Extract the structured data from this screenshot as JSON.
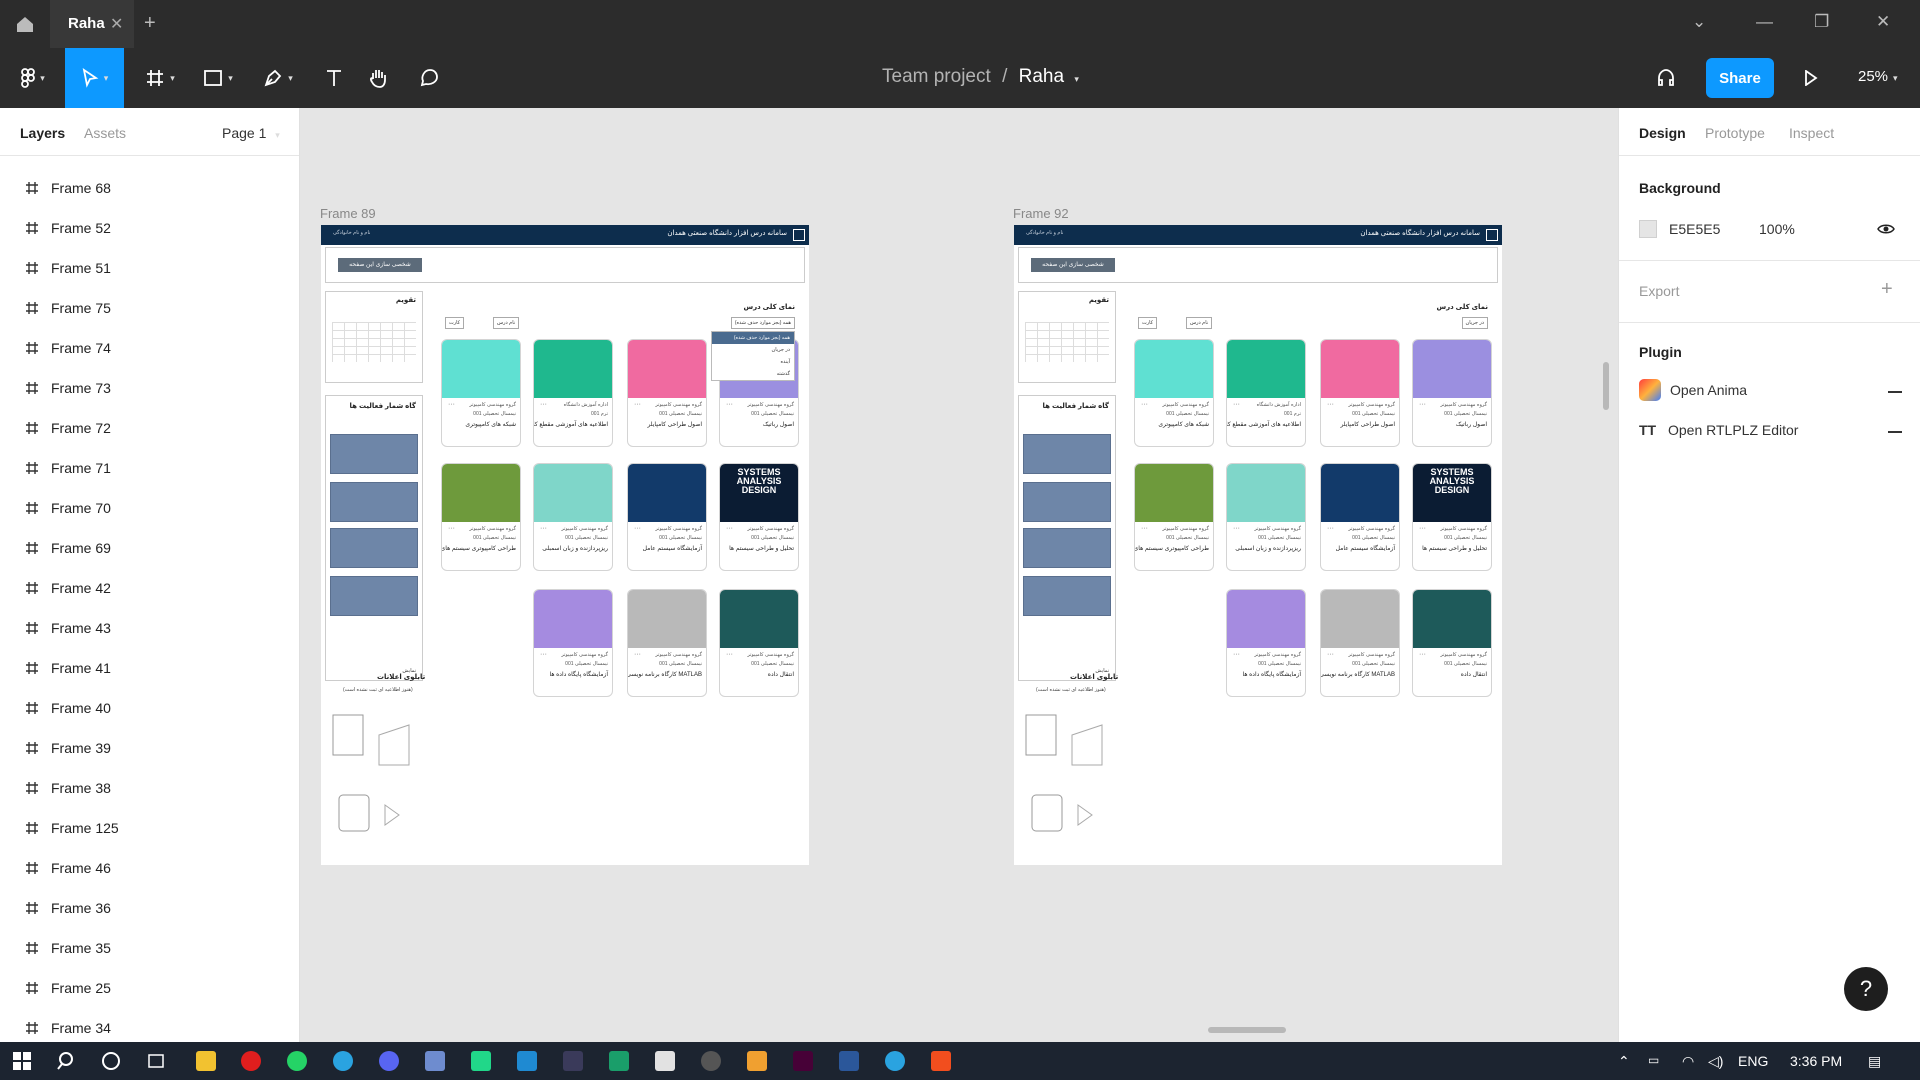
{
  "titlebar": {
    "tab_title": "Raha",
    "close_glyph": "✕",
    "new_tab_glyph": "+"
  },
  "toolbar": {
    "breadcrumb_team": "Team project",
    "breadcrumb_sep": "/",
    "breadcrumb_file": "Raha",
    "share_label": "Share",
    "zoom": "25%"
  },
  "left_panel": {
    "tab_layers": "Layers",
    "tab_assets": "Assets",
    "page": "Page 1",
    "layers": [
      "Frame 68",
      "Frame 52",
      "Frame 51",
      "Frame 75",
      "Frame 74",
      "Frame 73",
      "Frame 72",
      "Frame 71",
      "Frame 70",
      "Frame 69",
      "Frame 42",
      "Frame 43",
      "Frame 41",
      "Frame 40",
      "Frame 39",
      "Frame 38",
      "Frame 125",
      "Frame 46",
      "Frame 36",
      "Frame 35",
      "Frame 25",
      "Frame 34"
    ]
  },
  "canvas": {
    "frame_a_label": "Frame 89",
    "frame_b_label": "Frame 92",
    "frame": {
      "header_title": "سامانه درس افزار دانشگاه صنعتی همدان",
      "header_user": "نام و نام خانوادگی",
      "customize_button": "شخصی سازی این صفحه",
      "calendar_title": "تقویم",
      "activity_title": "گاه شمار فعالیت ها",
      "notice_title": "تابلوی اعلانات",
      "notice_empty": "(هنوز اطلاعیه ای ثبت نشده است)",
      "overview_title": "نمای کلی درس",
      "filter_a": "همه (بجز موارد حذف شده)",
      "filter_b": "در جریان",
      "sort_label": "نام درس",
      "view_label": "کارت",
      "menu_items": [
        "همه (بجز موارد حذف شده)",
        "در جریان",
        "آینده",
        "گذشته"
      ],
      "show_more": "نمایش"
    },
    "cards": [
      {
        "dept": "گروه مهندسی کامپیوتر",
        "term": "نیمسال تحصیلی 001",
        "name": "اصول رباتیک",
        "color": "#9b8fe0"
      },
      {
        "dept": "گروه مهندسی کامپیوتر",
        "term": "نیمسال تحصیلی 001",
        "name": "اصول طراحی کامپایلر",
        "color": "#f06aa0"
      },
      {
        "dept": "اداره آموزش دانشگاه",
        "term": "ترم 001",
        "name": "اطلاعیه های آموزشی مقطع کارشناسی",
        "color": "#1fb88e"
      },
      {
        "dept": "گروه مهندسی کامپیوتر",
        "term": "نیمسال تحصیلی 001",
        "name": "شبکه های کامپیوتری",
        "color": "#5fe0d2"
      },
      {
        "dept": "گروه مهندسی کامپیوتر",
        "term": "نیمسال تحصیلی 001",
        "name": "تحلیل و طراحی سیستم ها",
        "color": "#0b1c33"
      },
      {
        "dept": "گروه مهندسی کامپیوتر",
        "term": "نیمسال تحصیلی 001",
        "name": "آزمایشگاه سیستم عامل",
        "color": "#123a6a"
      },
      {
        "dept": "گروه مهندسی کامپیوتر",
        "term": "نیمسال تحصیلی 001",
        "name": "ریزپردازنده و زبان اسمبلی",
        "color": "#7fd6c9"
      },
      {
        "dept": "گروه مهندسی کامپیوتر",
        "term": "نیمسال تحصیلی 001",
        "name": "طراحی کامپیوتری سیستم های دیجیتال",
        "color": "#6e9a3c"
      },
      {
        "dept": "گروه مهندسی کامپیوتر",
        "term": "نیمسال تحصیلی 001",
        "name": "انتقال داده",
        "color": "#1e5a5a"
      },
      {
        "dept": "گروه مهندسی کامپیوتر",
        "term": "نیمسال تحصیلی 001",
        "name": "کارگاه برنامه نویسی MATLAB",
        "color": "#b9b9b9"
      },
      {
        "dept": "گروه مهندسی کامپیوتر",
        "term": "نیمسال تحصیلی 001",
        "name": "آزمایشگاه پایگاه داده ها",
        "color": "#a58be0"
      }
    ],
    "systems_text": "SYSTEMS ANALYSIS DESIGN"
  },
  "right_panel": {
    "tab_design": "Design",
    "tab_prototype": "Prototype",
    "tab_inspect": "Inspect",
    "background_title": "Background",
    "bg_hex": "E5E5E5",
    "bg_opacity": "100%",
    "export_title": "Export",
    "plugin_title": "Plugin",
    "plugin_1": "Open Anima",
    "plugin_2": "Open RTLPLZ Editor",
    "help": "?"
  },
  "taskbar": {
    "lang": "ENG",
    "time": "3:36 PM"
  },
  "colors": {
    "accent": "#0d99ff",
    "chrome": "#2c2c2c",
    "canvas": "#e5e5e5",
    "frame_header": "#0d2d4d"
  }
}
